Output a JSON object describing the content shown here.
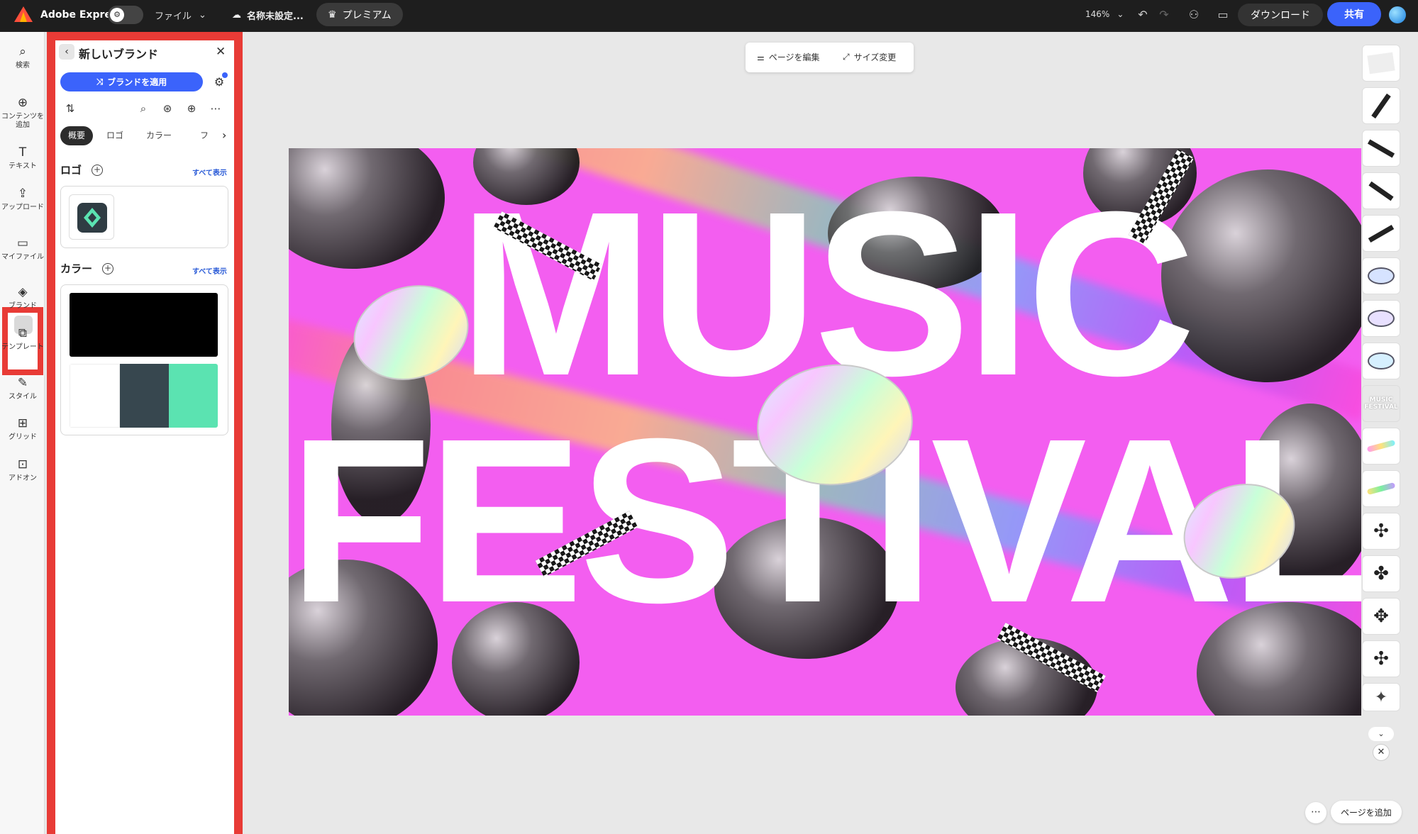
{
  "topbar": {
    "app_name": "Adobe Express",
    "file_menu": "ファイル",
    "doc_title": "名称未設定...",
    "premium": "プレミアム",
    "zoom": "146%",
    "download": "ダウンロード",
    "share": "共有"
  },
  "rail": {
    "items": [
      {
        "label": "検索",
        "icon": "search-icon"
      },
      {
        "label": "コンテンツを追加",
        "icon": "add-content-icon"
      },
      {
        "label": "テキスト",
        "icon": "text-icon"
      },
      {
        "label": "アップロード",
        "icon": "upload-icon"
      },
      {
        "label": "マイファイル",
        "icon": "folder-icon"
      },
      {
        "label": "ブランド",
        "icon": "brand-icon"
      },
      {
        "label": "テンプレート",
        "icon": "template-icon"
      },
      {
        "label": "スタイル",
        "icon": "style-icon"
      },
      {
        "label": "グリッド",
        "icon": "grid-icon"
      },
      {
        "label": "アドオン",
        "icon": "addon-icon"
      }
    ]
  },
  "panel": {
    "title": "新しいブランド",
    "apply_button": "ブランドを適用",
    "tabs": [
      "概要",
      "ロゴ",
      "カラー",
      "フォ"
    ],
    "logo_section": {
      "title": "ロゴ",
      "see_all": "すべて表示"
    },
    "color_section": {
      "title": "カラー",
      "see_all": "すべて表示",
      "primary": "#000000",
      "palette": [
        "#ffffff",
        "#37474f",
        "#5be3b1"
      ]
    }
  },
  "page_toolbar": {
    "edit_page": "ページを編集",
    "resize": "サイズ変更"
  },
  "artwork": {
    "line1": "MUSIC",
    "line2": "FESTIVAL",
    "background": "#f35ef0"
  },
  "bottom": {
    "add_page": "ページを追加"
  }
}
